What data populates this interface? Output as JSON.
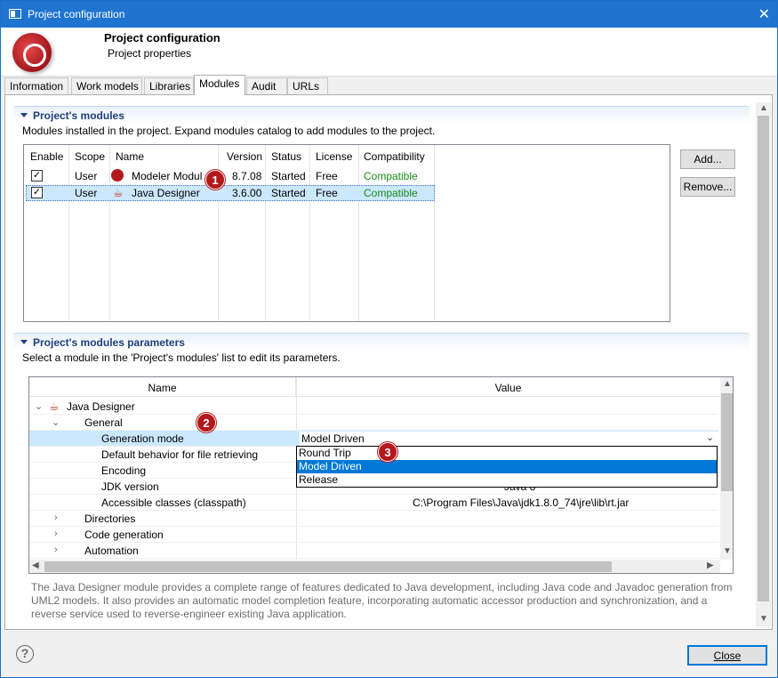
{
  "window": {
    "title": "Project configuration",
    "close_glyph": "✕"
  },
  "banner": {
    "title": "Project configuration",
    "subtitle": "Project properties"
  },
  "tabs": [
    {
      "label": "Information"
    },
    {
      "label": "Work models"
    },
    {
      "label": "Libraries"
    },
    {
      "label": "Modules",
      "active": true
    },
    {
      "label": "Audit"
    },
    {
      "label": "URLs"
    }
  ],
  "modules_section": {
    "title": "Project's modules",
    "description": "Modules installed in the project. Expand modules catalog to add modules to the project.",
    "columns": [
      "Enable",
      "Scope",
      "Name",
      "Version",
      "Status",
      "License",
      "Compatibility"
    ],
    "rows": [
      {
        "enabled": true,
        "scope": "User",
        "name": "Modeler Modul",
        "version": "8.7.08",
        "status": "Started",
        "license": "Free",
        "compatibility": "Compatible",
        "icon": "modelio-logo-icon"
      },
      {
        "enabled": true,
        "scope": "User",
        "name": "Java Designer",
        "version": "3.6.00",
        "status": "Started",
        "license": "Free",
        "compatibility": "Compatible",
        "icon": "java-cup-icon",
        "selected": true
      }
    ],
    "add_label": "Add...",
    "remove_label": "Remove..."
  },
  "params_section": {
    "title": "Project's modules parameters",
    "description": "Select a module in the 'Project's modules' list to edit its parameters.",
    "col_name": "Name",
    "col_value": "Value",
    "tree": {
      "module": "Java Designer",
      "general": "General",
      "params": [
        {
          "name": "Generation mode",
          "value": "Model Driven"
        },
        {
          "name": "Default behavior for file retrieving",
          "value": ""
        },
        {
          "name": "Encoding",
          "value": ""
        },
        {
          "name": "JDK version",
          "value": "Java 8"
        },
        {
          "name": "Accessible classes (classpath)",
          "value": "C:\\Program Files\\Java\\jdk1.8.0_74\\jre\\lib\\rt.jar"
        }
      ],
      "groups": [
        "Directories",
        "Code generation",
        "Automation"
      ]
    },
    "dropdown": {
      "options": [
        "Round Trip",
        "Model Driven",
        "Release"
      ],
      "selected": "Model Driven"
    }
  },
  "callouts": [
    "1",
    "2",
    "3"
  ],
  "footer_description": "The Java Designer module provides a complete range of features dedicated to Java development, including Java code and Javadoc generation from UML2 models. It also provides an automatic model completion feature, incorporating automatic accessor production and synchronization, and a reverse service used to reverse-engineer existing Java application.",
  "buttons": {
    "help": "?",
    "close": "Close"
  },
  "glyphs": {
    "check": "✓",
    "caret_down": "⌄",
    "caret_right": "›",
    "combo_arrow": "⌄",
    "arrow_up": "▲",
    "arrow_down": "▼",
    "arrow_left": "◀",
    "arrow_right": "▶"
  },
  "colors": {
    "titlebar": "#1e74cf",
    "accent": "#0078d7",
    "badge": "#b3191c",
    "compatible": "#1a8a1a",
    "section_title": "#1d3f7a"
  }
}
